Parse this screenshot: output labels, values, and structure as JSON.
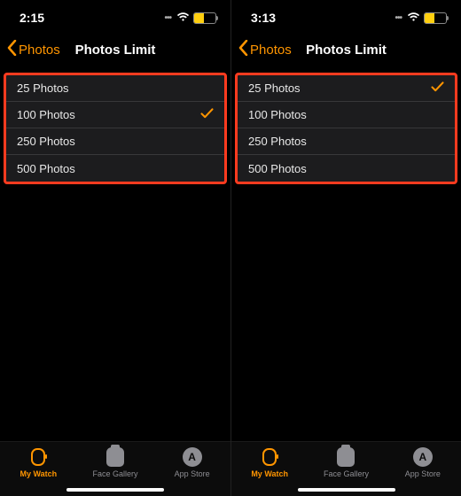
{
  "accent": "#ff9500",
  "battery_fill": "#ffcf0f",
  "panes": [
    {
      "time": "2:15",
      "battery_pct": 45,
      "back_label": "Photos",
      "title": "Photos Limit",
      "options": [
        {
          "label": "25 Photos",
          "selected": false
        },
        {
          "label": "100 Photos",
          "selected": true
        },
        {
          "label": "250 Photos",
          "selected": false
        },
        {
          "label": "500 Photos",
          "selected": false
        }
      ]
    },
    {
      "time": "3:13",
      "battery_pct": 45,
      "back_label": "Photos",
      "title": "Photos Limit",
      "options": [
        {
          "label": "25 Photos",
          "selected": true
        },
        {
          "label": "100 Photos",
          "selected": false
        },
        {
          "label": "250 Photos",
          "selected": false
        },
        {
          "label": "500 Photos",
          "selected": false
        }
      ]
    }
  ],
  "tabs": [
    {
      "id": "my-watch",
      "label": "My Watch",
      "active": true
    },
    {
      "id": "face-gallery",
      "label": "Face Gallery",
      "active": false
    },
    {
      "id": "app-store",
      "label": "App Store",
      "active": false
    }
  ]
}
